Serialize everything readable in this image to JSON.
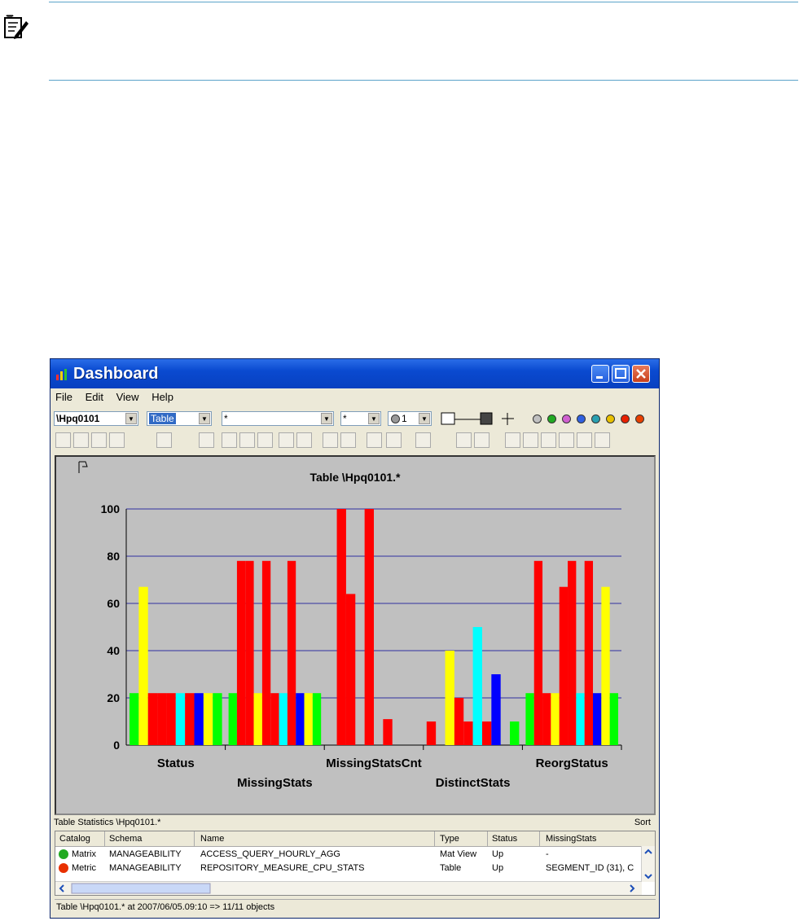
{
  "window": {
    "title": "Dashboard",
    "menu": [
      "File",
      "Edit",
      "View",
      "Help"
    ],
    "toolbar": {
      "system": "\\Hpq0101",
      "object_type": "Table",
      "schema_filter": "*",
      "name_filter": "*",
      "counter": "1"
    },
    "status_dot_colors": [
      "#c0c0c0",
      "#22aa22",
      "#d060d0",
      "#3060e0",
      "#2aa0b0",
      "#e8c000",
      "#e82000",
      "#e84000"
    ]
  },
  "chart_data": {
    "type": "bar",
    "title": "Table \\Hpq0101.*",
    "ylim": [
      0,
      100
    ],
    "yticks": [
      0,
      20,
      40,
      60,
      80,
      100
    ],
    "grid": true,
    "groups": [
      {
        "label": "Status",
        "row": 0,
        "bars": [
          {
            "value": 22,
            "color": "#00ff00"
          },
          {
            "value": 67,
            "color": "#ffff00"
          },
          {
            "value": 22,
            "color": "#ff0000"
          },
          {
            "value": 22,
            "color": "#ff0000"
          },
          {
            "value": 22,
            "color": "#ff0000"
          },
          {
            "value": 22,
            "color": "#00ffff"
          },
          {
            "value": 22,
            "color": "#ff0000"
          },
          {
            "value": 22,
            "color": "#0000ff"
          },
          {
            "value": 22,
            "color": "#ffff00"
          },
          {
            "value": 22,
            "color": "#00ff00"
          }
        ]
      },
      {
        "label": "MissingStats",
        "row": 1,
        "bars": [
          {
            "value": 22,
            "color": "#00ff00"
          },
          {
            "value": 78,
            "color": "#ff0000"
          },
          {
            "value": 78,
            "color": "#ff0000"
          },
          {
            "value": 22,
            "color": "#ffff00"
          },
          {
            "value": 78,
            "color": "#ff0000"
          },
          {
            "value": 22,
            "color": "#ff0000"
          },
          {
            "value": 22,
            "color": "#00ffff"
          },
          {
            "value": 78,
            "color": "#ff0000"
          },
          {
            "value": 22,
            "color": "#0000ff"
          },
          {
            "value": 22,
            "color": "#ffff00"
          },
          {
            "value": 22,
            "color": "#00ff00"
          }
        ]
      },
      {
        "label": "MissingStatsCnt",
        "row": 0,
        "bars": [
          {
            "value": 0,
            "color": "#00ff00"
          },
          {
            "value": 100,
            "color": "#ff0000"
          },
          {
            "value": 64,
            "color": "#ff0000"
          },
          {
            "value": 0,
            "color": "#ffff00"
          },
          {
            "value": 100,
            "color": "#ff0000"
          },
          {
            "value": 0,
            "color": "#ff0000"
          },
          {
            "value": 11,
            "color": "#ff0000"
          },
          {
            "value": 0,
            "color": "#00ffff"
          },
          {
            "value": 0,
            "color": "#0000ff"
          },
          {
            "value": 0,
            "color": "#ffff00"
          }
        ]
      },
      {
        "label": "DistinctStats",
        "row": 1,
        "bars": [
          {
            "value": 10,
            "color": "#ff0000"
          },
          {
            "value": 0,
            "color": "#00ff00"
          },
          {
            "value": 40,
            "color": "#ffff00"
          },
          {
            "value": 20,
            "color": "#ff0000"
          },
          {
            "value": 10,
            "color": "#ff0000"
          },
          {
            "value": 50,
            "color": "#00ffff"
          },
          {
            "value": 10,
            "color": "#ff0000"
          },
          {
            "value": 30,
            "color": "#0000ff"
          },
          {
            "value": 0,
            "color": "#ffff00"
          },
          {
            "value": 10,
            "color": "#00ff00"
          }
        ]
      },
      {
        "label": "ReorgStatus",
        "row": 0,
        "bars": [
          {
            "value": 22,
            "color": "#00ff00"
          },
          {
            "value": 78,
            "color": "#ff0000"
          },
          {
            "value": 22,
            "color": "#ff0000"
          },
          {
            "value": 22,
            "color": "#ffff00"
          },
          {
            "value": 67,
            "color": "#ff0000"
          },
          {
            "value": 78,
            "color": "#ff0000"
          },
          {
            "value": 22,
            "color": "#00ffff"
          },
          {
            "value": 78,
            "color": "#ff0000"
          },
          {
            "value": 22,
            "color": "#0000ff"
          },
          {
            "value": 67,
            "color": "#ffff00"
          },
          {
            "value": 22,
            "color": "#00ff00"
          }
        ]
      }
    ]
  },
  "panel": {
    "title": "Table Statistics \\Hpq0101.*",
    "sort": "Sort",
    "columns": [
      "Catalog",
      "Schema",
      "Name",
      "Type",
      "Status",
      "MissingStats"
    ],
    "rows": [
      {
        "icon_color": "#22aa22",
        "catalog": "Matrix",
        "schema": "MANAGEABILITY",
        "name": "ACCESS_QUERY_HOURLY_AGG",
        "type": "Mat View",
        "status": "Up",
        "missing": "-"
      },
      {
        "icon_color": "#e83000",
        "catalog": "Metric",
        "schema": "MANAGEABILITY",
        "name": "REPOSITORY_MEASURE_CPU_STATS",
        "type": "Table",
        "status": "Up",
        "missing": "SEGMENT_ID (31), C"
      }
    ],
    "status_text": "Table \\Hpq0101.* at 2007/06/05.09:10 => 11/11 objects"
  }
}
